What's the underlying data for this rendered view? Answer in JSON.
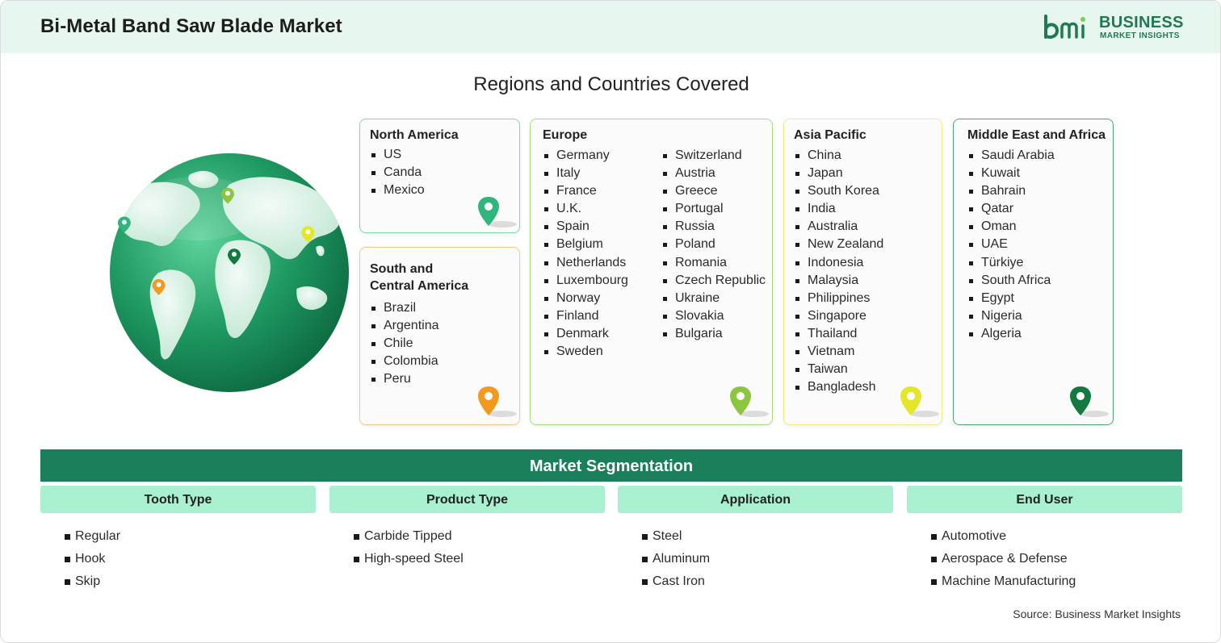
{
  "header": {
    "title": "Bi-Metal Band Saw Blade Market",
    "logo": {
      "line1": "BUSINESS",
      "line2": "MARKET INSIGHTS",
      "mark": "bmi"
    }
  },
  "regions_title": "Regions and Countries Covered",
  "regions": {
    "north_america": {
      "name": "North America",
      "countries": [
        "US",
        "Canda",
        "Mexico"
      ],
      "color": "#3fbf8a",
      "pin_color": "#2fb57d"
    },
    "south_central_america": {
      "name": "South and\nCentral America",
      "countries": [
        "Brazil",
        "Argentina",
        "Chile",
        "Colombia",
        "Peru"
      ],
      "color": "#f6c98a",
      "pin_color": "#f29a1f"
    },
    "europe": {
      "name": "Europe",
      "countries_col1": [
        "Germany",
        "Italy",
        "France",
        "U.K.",
        "Spain",
        "Belgium",
        "Netherlands",
        "Luxembourg",
        "Norway",
        "Finland",
        "Denmark",
        "Sweden"
      ],
      "countries_col2": [
        "Switzerland",
        "Austria",
        "Greece",
        "Portugal",
        "Russia",
        "Poland",
        "Romania",
        "Czech Republic",
        "Ukraine",
        "Slovakia",
        "Bulgaria"
      ],
      "color": "#a6dc7a",
      "pin_color": "#8cc63f"
    },
    "asia_pacific": {
      "name": "Asia Pacific",
      "countries": [
        "China",
        "Japan",
        "South Korea",
        "India",
        "Australia",
        "New Zealand",
        "Indonesia",
        "Malaysia",
        "Philippines",
        "Singapore",
        "Thailand",
        "Vietnam",
        "Taiwan",
        "Bangladesh"
      ],
      "color": "#ecef7a",
      "pin_color": "#e4e629"
    },
    "middle_east_africa": {
      "name": "Middle East and Africa",
      "countries": [
        "Saudi Arabia",
        "Kuwait",
        "Bahrain",
        "Qatar",
        "Oman",
        "UAE",
        "Türkiye",
        "South Africa",
        "Egypt",
        "Nigeria",
        "Algeria"
      ],
      "color": "#4aa876",
      "pin_color": "#137a3f"
    }
  },
  "segmentation": {
    "title": "Market Segmentation",
    "columns": [
      {
        "heading": "Tooth Type",
        "items": [
          "Regular",
          "Hook",
          "Skip"
        ]
      },
      {
        "heading": "Product Type",
        "items": [
          "Carbide Tipped",
          "High-speed Steel"
        ]
      },
      {
        "heading": "Application",
        "items": [
          "Steel",
          "Aluminum",
          "Cast Iron"
        ]
      },
      {
        "heading": "End User",
        "items": [
          "Automotive",
          "Aerospace & Defense",
          "Machine Manufacturing"
        ]
      }
    ]
  },
  "source": "Source: Business Market Insights",
  "icons": [
    "globe-icon",
    "map-pin-icon",
    "bmi-logo-icon"
  ]
}
